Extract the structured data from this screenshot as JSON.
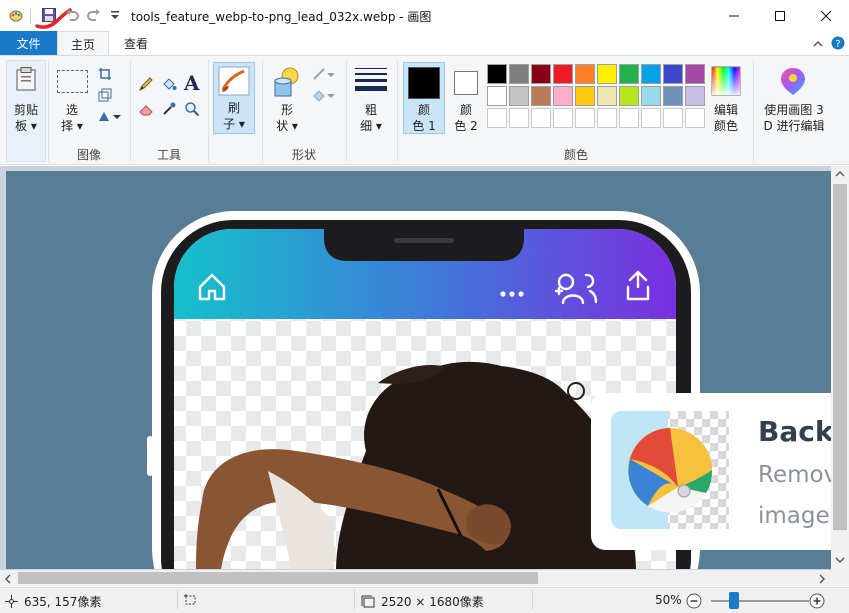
{
  "window": {
    "title": "tools_feature_webp-to-png_lead_032x.webp - 画图"
  },
  "tabs": {
    "file": "文件",
    "home": "主页",
    "view": "查看"
  },
  "ribbon": {
    "clipboard": {
      "label_line1": "剪贴",
      "label_line2": "板",
      "group": ""
    },
    "image": {
      "select_line1": "选",
      "select_line2": "择",
      "group": "图像"
    },
    "tools": {
      "group": "工具"
    },
    "brushes": {
      "label_line1": "刷",
      "label_line2": "子"
    },
    "shapes": {
      "label_line1": "形",
      "label_line2": "状",
      "group": "形状"
    },
    "size": {
      "label_line1": "粗",
      "label_line2": "细"
    },
    "colors": {
      "color1_line1": "颜",
      "color1_line2": "色 1",
      "color2_line1": "颜",
      "color2_line2": "色 2",
      "edit_line1": "编辑",
      "edit_line2": "颜色",
      "group": "颜色",
      "color1_value": "#000000",
      "color2_value": "#ffffff",
      "palette_row1": [
        "#000000",
        "#7f7f7f",
        "#880015",
        "#ed1c24",
        "#ff7f27",
        "#fff200",
        "#22b14c",
        "#00a2e8",
        "#3f48cc",
        "#a349a4"
      ],
      "palette_row2": [
        "#ffffff",
        "#c3c3c3",
        "#b97a57",
        "#ffaec9",
        "#ffc90e",
        "#efe4b0",
        "#b5e61d",
        "#99d9ea",
        "#7092be",
        "#c8bfe7"
      ]
    },
    "paint3d": {
      "line1": "使用画图 3",
      "line2": "D 进行编辑"
    }
  },
  "canvas_content": {
    "card_title": "Backg",
    "card_line1": "Remov",
    "card_line2": "image"
  },
  "statusbar": {
    "cursor_pos": "635, 157像素",
    "selection_size": "",
    "image_size": "2520 × 1680像素",
    "zoom": "50%"
  }
}
